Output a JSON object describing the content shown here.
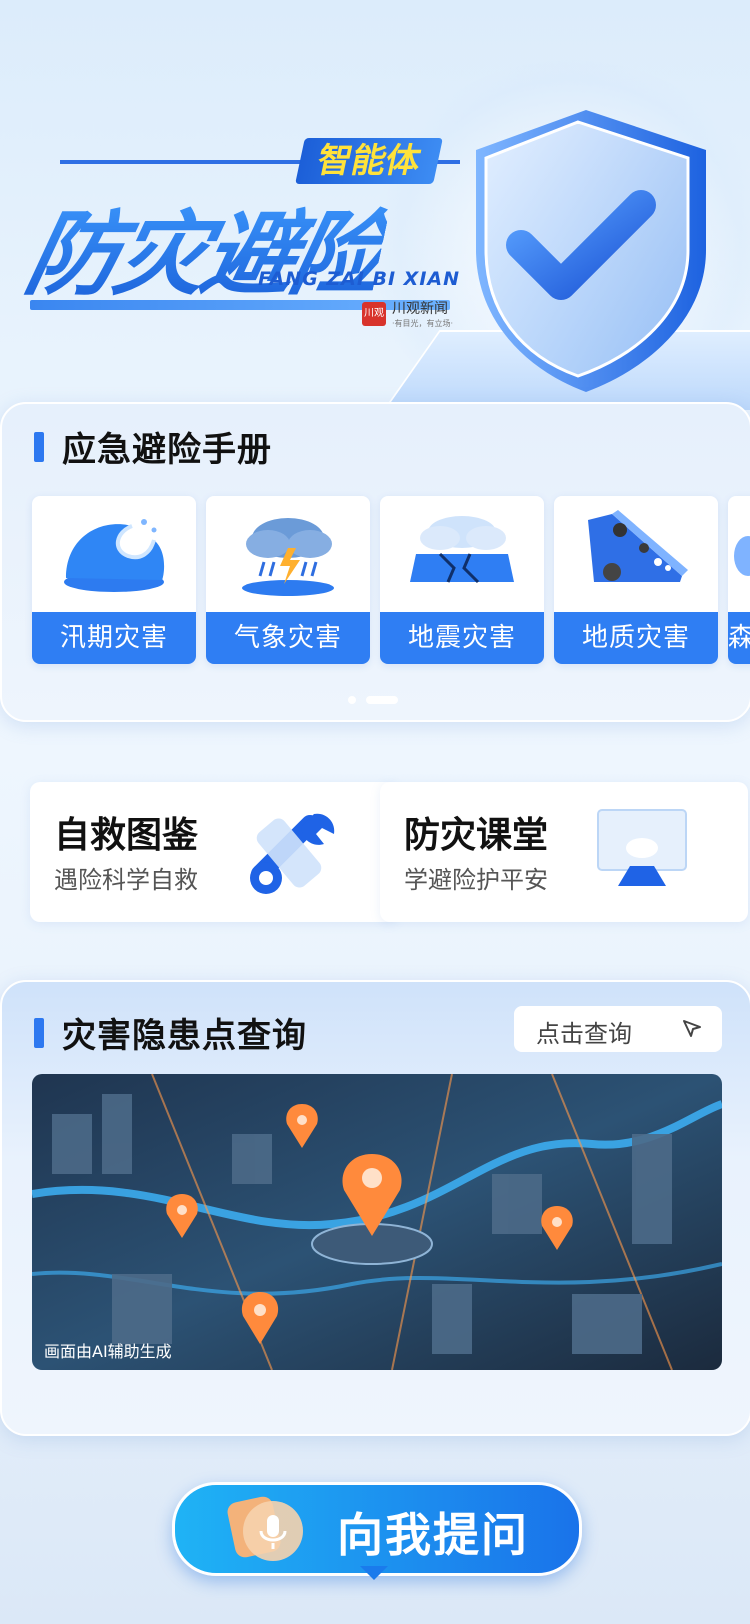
{
  "hero": {
    "title": "防灾避险",
    "tag": "智能体",
    "pinyin": "FANG ZAI BI XIAN",
    "brand_mark": "川观",
    "brand_name": "川观新闻",
    "brand_sub": "·有目光，有立场·"
  },
  "manual": {
    "title": "应急避险手册",
    "items": [
      {
        "label": "汛期灾害",
        "icon": "flood-wave-icon"
      },
      {
        "label": "气象灾害",
        "icon": "storm-cloud-icon"
      },
      {
        "label": "地震灾害",
        "icon": "earthquake-icon"
      },
      {
        "label": "地质灾害",
        "icon": "landslide-icon"
      },
      {
        "label": "森",
        "icon": "forest-fire-icon"
      }
    ],
    "pager": {
      "total": 2,
      "active": 2
    }
  },
  "shortcuts": [
    {
      "title": "自救图鉴",
      "subtitle": "遇险科学自救",
      "icon": "wrench-icon"
    },
    {
      "title": "防灾课堂",
      "subtitle": "学避险护平安",
      "icon": "classroom-screen-icon"
    }
  ],
  "query": {
    "title": "灾害隐患点查询",
    "button_label": "点击查询",
    "button_icon": "cursor-click-icon",
    "map_note": "画面由AI辅助生成"
  },
  "ask": {
    "label": "向我提问",
    "icon": "microphone-icon"
  },
  "colors": {
    "accent": "#2f7ef3",
    "title_blue": "#2a74ea",
    "tag_yellow": "#ffe23a",
    "map_pin": "#ff8a3c"
  }
}
